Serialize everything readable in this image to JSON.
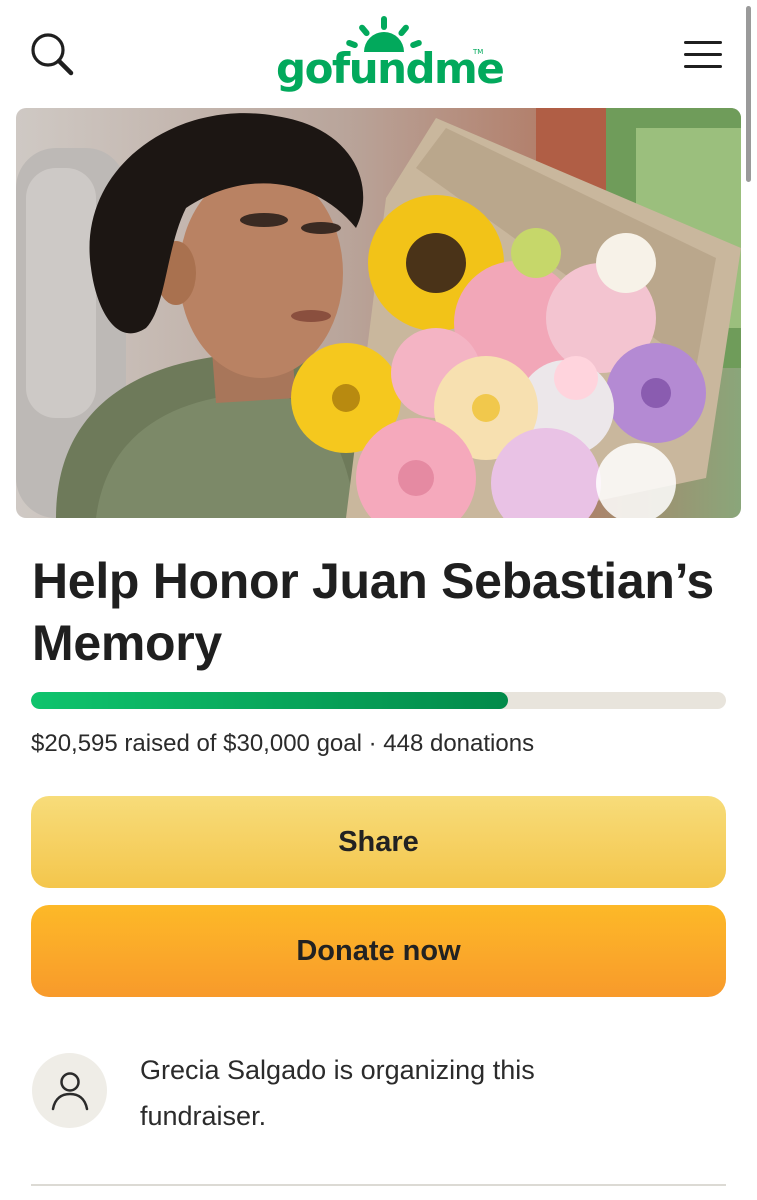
{
  "header": {
    "logo_text": "gofundme",
    "logo_tm": "TM",
    "search_icon": "search-icon",
    "menu_icon": "hamburger-menu-icon",
    "brand_color": "#02a95c"
  },
  "hero": {
    "image": "photo"
  },
  "campaign": {
    "title": "Help Honor Juan Sebastian’s Memory",
    "raised": 20595,
    "goal": 30000,
    "progress_fraction": 0.686,
    "stats_text": "$20,595 raised of $30,000 goal · 448 donations"
  },
  "actions": {
    "share_label": "Share",
    "donate_label": "Donate now"
  },
  "organizer": {
    "avatar_icon": "user-icon",
    "text": "Grecia Salgado is organizing this fundraiser."
  }
}
